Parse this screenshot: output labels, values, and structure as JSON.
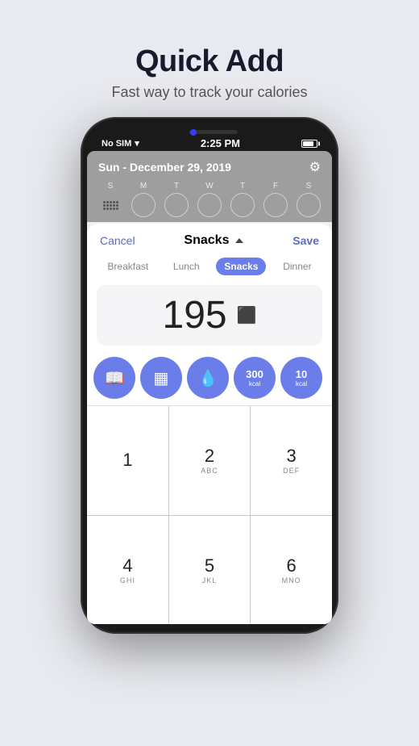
{
  "header": {
    "title": "Quick Add",
    "subtitle": "Fast way to track your calories"
  },
  "phone": {
    "status_bar": {
      "carrier": "No SIM",
      "time": "2:25 PM"
    },
    "calendar": {
      "date": "Sun - December 29, 2019",
      "week_days": [
        "S",
        "M",
        "T",
        "W",
        "T",
        "F",
        "S"
      ]
    },
    "modal": {
      "cancel_label": "Cancel",
      "title": "Snacks",
      "save_label": "Save",
      "meal_tabs": [
        "Breakfast",
        "Lunch",
        "Snacks",
        "Dinner"
      ],
      "calorie_value": "195",
      "action_buttons": [
        {
          "icon": "📖",
          "type": "icon"
        },
        {
          "icon": "📊",
          "type": "icon"
        },
        {
          "icon": "💧",
          "type": "icon"
        },
        {
          "kcal": "300",
          "label": "kcal",
          "type": "kcal"
        },
        {
          "kcal": "10",
          "label": "kcal",
          "type": "kcal"
        }
      ]
    },
    "numpad": {
      "keys": [
        {
          "num": "1",
          "letters": ""
        },
        {
          "num": "2",
          "letters": "ABC"
        },
        {
          "num": "3",
          "letters": "DEF"
        },
        {
          "num": "4",
          "letters": "GHI"
        },
        {
          "num": "5",
          "letters": "JKL"
        },
        {
          "num": "6",
          "letters": "MNO"
        }
      ]
    }
  }
}
